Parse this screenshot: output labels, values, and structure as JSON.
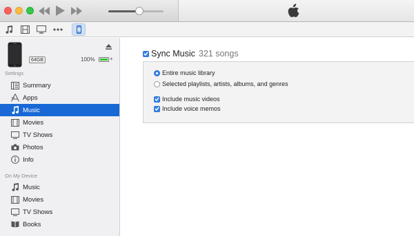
{
  "window": {
    "colors": {
      "close": "#fc605c",
      "minimize": "#fdbc40",
      "zoom": "#34c84a"
    },
    "volume_level": 0.56
  },
  "toolbar": {
    "icons": [
      "music-note-icon",
      "film-icon",
      "tv-icon",
      "more-icon",
      "iphone-icon"
    ]
  },
  "device": {
    "capacity": "64GB",
    "battery": "100%",
    "battery_level": 1.0
  },
  "sidebar": {
    "settings_label": "Settings",
    "settings_items": [
      {
        "label": "Summary",
        "icon": "summary-icon"
      },
      {
        "label": "Apps",
        "icon": "apps-icon"
      },
      {
        "label": "Music",
        "icon": "music-note-icon",
        "active": true
      },
      {
        "label": "Movies",
        "icon": "film-icon"
      },
      {
        "label": "TV Shows",
        "icon": "tv-icon"
      },
      {
        "label": "Photos",
        "icon": "camera-icon"
      },
      {
        "label": "Info",
        "icon": "info-icon"
      }
    ],
    "device_label": "On My Device",
    "device_items": [
      {
        "label": "Music",
        "icon": "music-note-icon"
      },
      {
        "label": "Movies",
        "icon": "film-icon"
      },
      {
        "label": "TV Shows",
        "icon": "tv-icon"
      },
      {
        "label": "Books",
        "icon": "book-icon"
      }
    ],
    "accent": "#1869d6"
  },
  "main": {
    "sync_label": "Sync Music",
    "sync_checked": true,
    "song_count": "321 songs",
    "options": [
      {
        "label": "Entire music library",
        "type": "radio",
        "checked": true
      },
      {
        "label": "Selected playlists, artists, albums, and genres",
        "type": "radio",
        "checked": false
      },
      {
        "label": "Include music videos",
        "type": "checkbox",
        "checked": true
      },
      {
        "label": "Include voice memos",
        "type": "checkbox",
        "checked": true
      }
    ]
  }
}
